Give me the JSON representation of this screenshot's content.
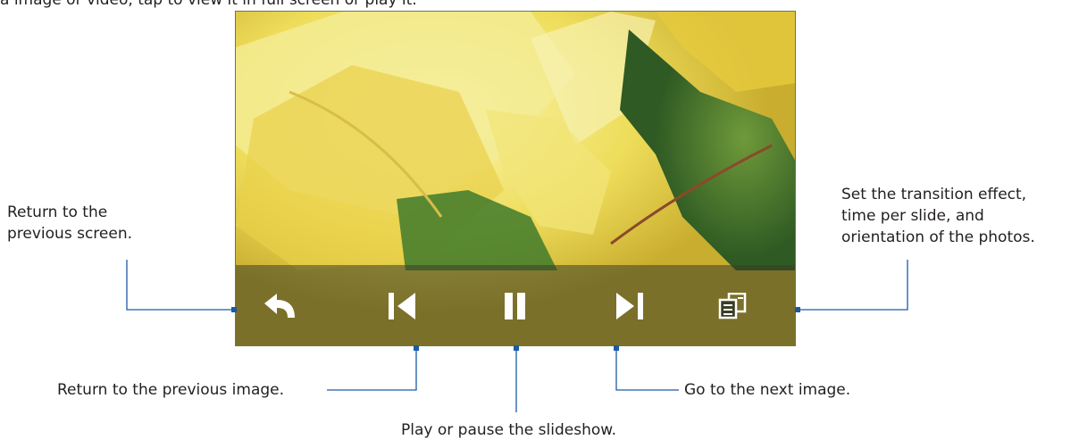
{
  "intro_text": "a image or video, tap to view it in full screen or play it.",
  "controls": [
    {
      "name": "back-button",
      "icon": "back-arrow-icon"
    },
    {
      "name": "previous-image-button",
      "icon": "skip-previous-icon"
    },
    {
      "name": "play-pause-button",
      "icon": "pause-icon"
    },
    {
      "name": "next-image-button",
      "icon": "skip-next-icon"
    },
    {
      "name": "slideshow-settings-button",
      "icon": "menu-list-icon"
    }
  ],
  "callouts": {
    "back": "Return to the previous screen.",
    "back_line1": "Return to the",
    "back_line2": "previous screen.",
    "previous": "Return to the previous image.",
    "play_pause": "Play or pause the slideshow.",
    "next": "Go to the next image.",
    "settings_line1": "Set the transition effect,",
    "settings_line2": "time per slide, and",
    "settings_line3": "orientation of the photos."
  },
  "colors": {
    "callout_line": "#1c5aa6",
    "toolbar_icon": "#ffffff",
    "toolbar_overlay": "#3a3e26"
  }
}
